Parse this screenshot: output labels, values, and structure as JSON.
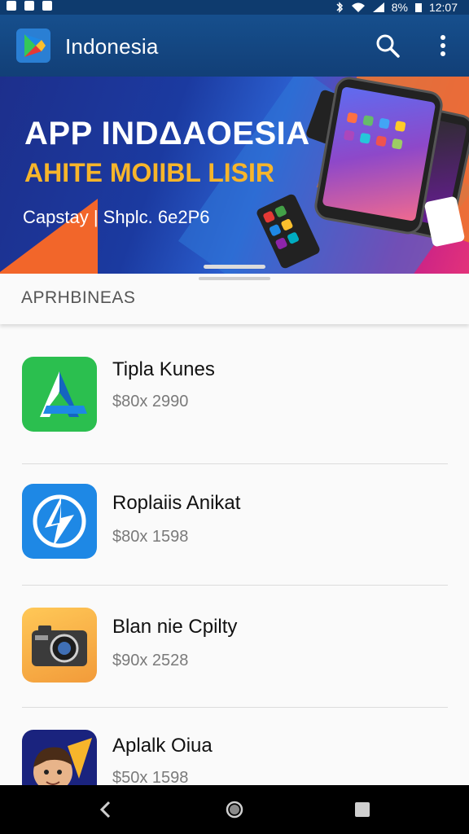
{
  "status_bar": {
    "battery": "8%",
    "time": "12:07"
  },
  "app_bar": {
    "title": "Indonesia"
  },
  "banner": {
    "headline": "APP INDΔAOESIA",
    "subheadline": "AHITE MOIIBL LISIR",
    "tagline": "Capstay | Shplc. 6e2P6"
  },
  "section": {
    "title": "APRHBINEAS"
  },
  "apps": [
    {
      "name": "Tipla Kunes",
      "meta": "$80x 2990",
      "icon": "green-arrow-icon"
    },
    {
      "name": "Roplaiis Anikat",
      "meta": "$80x 1598",
      "icon": "blue-lightning-icon"
    },
    {
      "name": "Blan nie Cpilty",
      "meta": "$90x 2528",
      "icon": "camera-icon"
    },
    {
      "name": "Aplalk Oiua",
      "meta": "$50x 1598",
      "icon": "avatar-icon"
    }
  ],
  "colors": {
    "app_bar": "#164f8d",
    "status_bar": "#0e3b6e",
    "accent_orange": "#f7b52b"
  }
}
